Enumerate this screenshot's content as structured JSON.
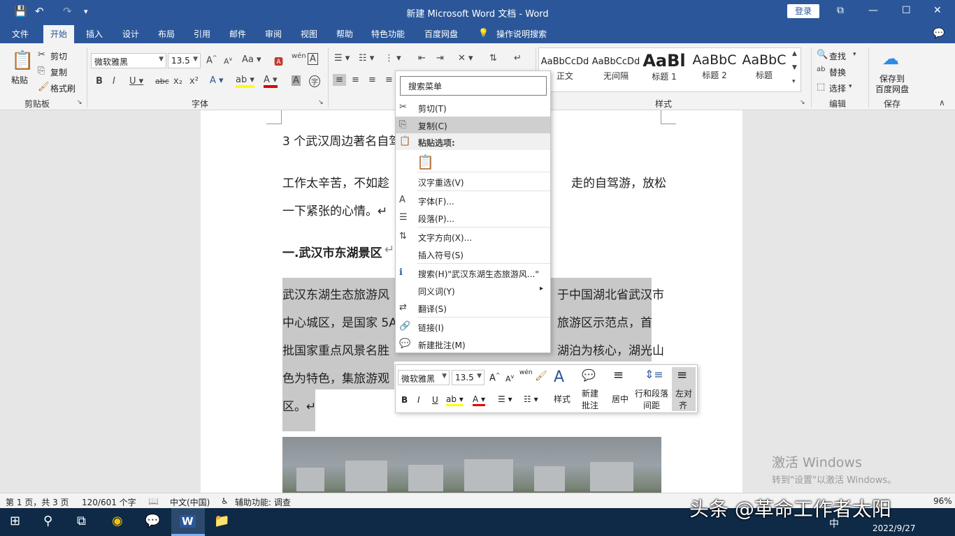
{
  "titlebar": {
    "title": "新建 Microsoft Word 文档 - Word",
    "login": "登录",
    "save_icon": "💾",
    "undo_icon": "↶",
    "redo_icon": "↷",
    "more_icon": "▾",
    "restore_icon": "⧉",
    "minimize_icon": "—",
    "maximize_icon": "☐",
    "close_icon": "✕"
  },
  "menu_tabs": [
    "文件",
    "开始",
    "插入",
    "设计",
    "布局",
    "引用",
    "邮件",
    "审阅",
    "视图",
    "帮助",
    "特色功能",
    "百度网盘"
  ],
  "tell_me": "操作说明搜索",
  "tell_me_icon": "💡",
  "feedback_icon": "💬",
  "ribbon": {
    "clipboard": {
      "paste": "粘贴",
      "cut": "剪切",
      "copy": "复制",
      "format_painter": "格式刷",
      "group": "剪贴板"
    },
    "font": {
      "name": "微软雅黑",
      "size": "13.5",
      "group": "字体"
    },
    "paragraph": {
      "group": "段落"
    },
    "styles": {
      "items": [
        {
          "preview": "AaBbCcDd",
          "name": "正文"
        },
        {
          "preview": "AaBbCcDd",
          "name": "无间隔"
        },
        {
          "preview": "AaBl",
          "name": "标题 1"
        },
        {
          "preview": "AaBbC",
          "name": "标题 2"
        },
        {
          "preview": "AaBbC",
          "name": "标题"
        }
      ],
      "group": "样式"
    },
    "editing": {
      "find": "查找",
      "replace": "替换",
      "select": "选择",
      "group": "编辑"
    },
    "save": {
      "label1": "保存到",
      "label2": "百度网盘",
      "group": "保存"
    }
  },
  "document": {
    "line1": "3 个武汉周边著名自驾",
    "para1_a": "工作太辛苦，不如趁",
    "para1_b": "走的自驾游，放松",
    "para1_line2": "一下紧张的心情。↵",
    "heading": "一.武汉市东湖景区",
    "heading_mark": "↵",
    "body_l1a": "武汉东湖生态旅游风",
    "body_l1b": "于中国湖北省武汉市",
    "body_l2a": "中心城区，是国家 5A",
    "body_l2b": "旅游区示范点，首",
    "body_l3a": "批国家重点风景名胜",
    "body_l3b": "湖泊为核心，湖光山",
    "body_l4a": "色为特色，集旅游观",
    "body_l5": "区。↵"
  },
  "context_menu": {
    "search": "搜索菜单",
    "items": [
      {
        "icon": "✂",
        "label": "剪切(T)"
      },
      {
        "icon": "⎘",
        "label": "复制(C)"
      },
      {
        "icon": "📋",
        "label": "粘贴选项:"
      },
      {
        "icon": "",
        "label": "汉字重选(V)"
      },
      {
        "icon": "A",
        "label": "字体(F)..."
      },
      {
        "icon": "☰",
        "label": "段落(P)..."
      },
      {
        "icon": "⇅",
        "label": "文字方向(X)..."
      },
      {
        "icon": "",
        "label": "插入符号(S)"
      },
      {
        "icon": "ℹ",
        "label": "搜索(H)\"武汉东湖生态旅游风...\""
      },
      {
        "icon": "",
        "label": "同义词(Y)"
      },
      {
        "icon": "⇄",
        "label": "翻译(S)"
      },
      {
        "icon": "🔗",
        "label": "链接(I)"
      },
      {
        "icon": "💬",
        "label": "新建批注(M)"
      }
    ],
    "paste_icon": "📋",
    "submenu_arrow": "▸"
  },
  "mini_toolbar": {
    "font": "微软雅黑",
    "size": "13.5",
    "style": "样式",
    "new_comment1": "新建",
    "new_comment2": "批注",
    "center": "居中",
    "line_spacing1": "行和段落",
    "line_spacing2": "间距",
    "left_align1": "左对",
    "left_align2": "齐"
  },
  "watermark": {
    "line1": "激活 Windows",
    "line2": "转到\"设置\"以激活 Windows。"
  },
  "statusbar": {
    "page": "第 1 页，共 3 页",
    "words": "120/601 个字",
    "lang": "中文(中国)",
    "accessibility": "辅助功能: 调查",
    "zoom": "96%"
  },
  "taskbar": {
    "date": "2022/9/27",
    "ime": "中"
  },
  "overlay": "头条 @革命工作者太阳"
}
